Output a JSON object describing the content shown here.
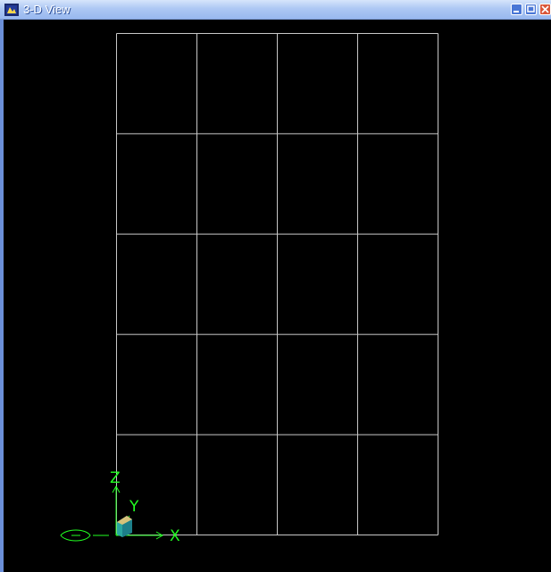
{
  "window": {
    "title": "3-D View",
    "icon": "sap-app-icon",
    "controls": [
      "minimize",
      "maximize",
      "close"
    ]
  },
  "view": {
    "grid_columns": 4,
    "grid_rows": 5,
    "line_color": "#c8c8c8",
    "background": "#000000",
    "axis_color": "#22ff22",
    "axes": {
      "x_label": "X",
      "y_label": "Y",
      "z_label": "Z"
    }
  }
}
